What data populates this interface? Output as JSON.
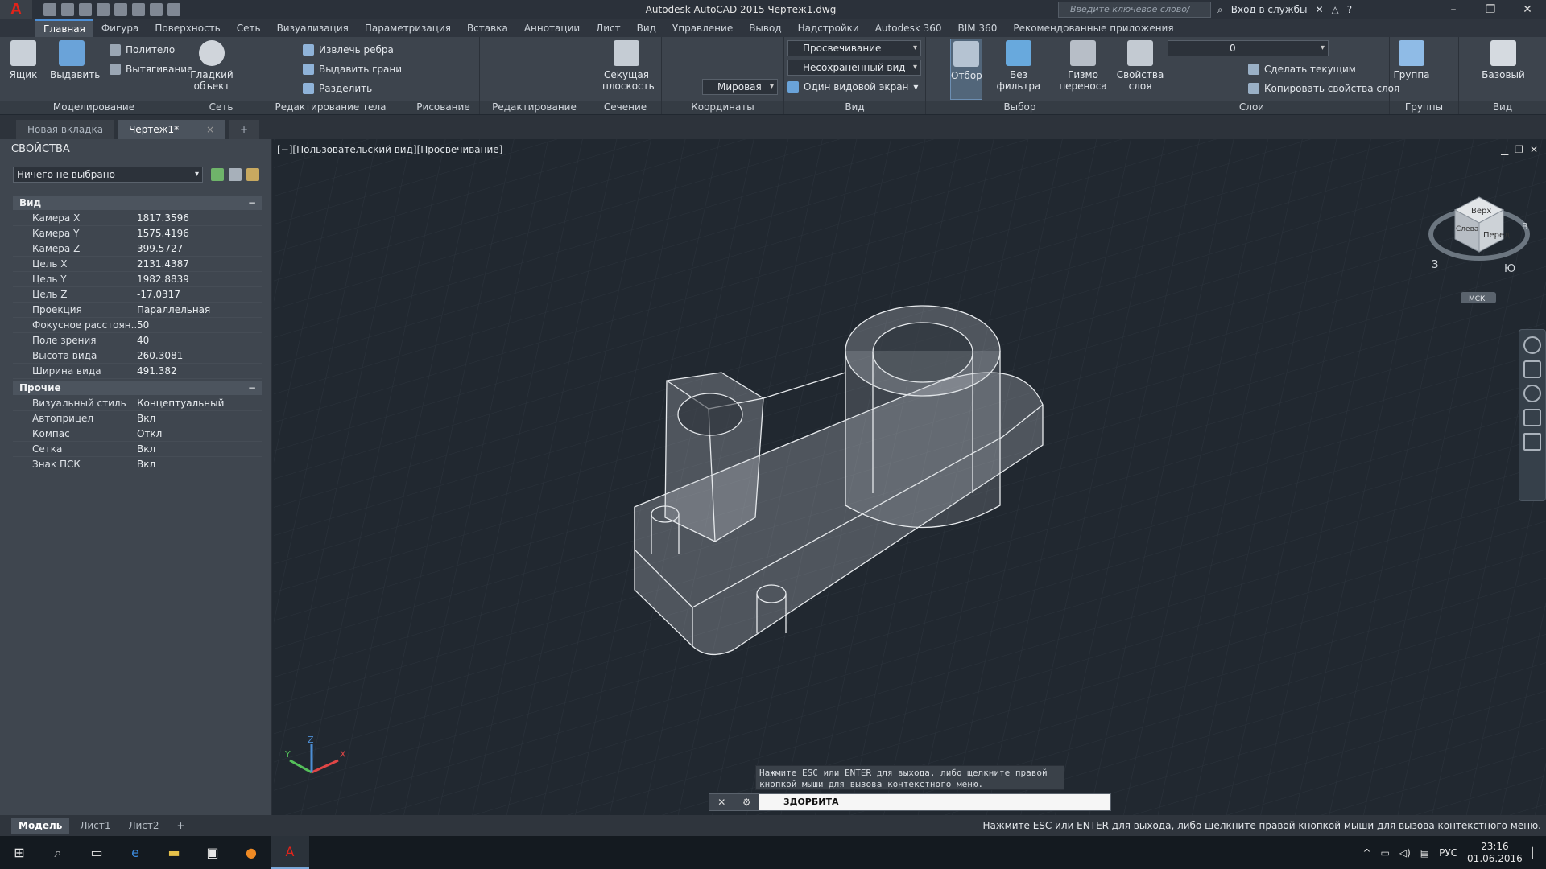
{
  "titlebar": {
    "title": "Autodesk AutoCAD 2015    Чертеж1.dwg",
    "search_placeholder": "Введите ключевое слово/фразу",
    "signin": "Вход в службы",
    "help": "?"
  },
  "ribbon_tabs": [
    "Главная",
    "Фигура",
    "Поверхность",
    "Сеть",
    "Визуализация",
    "Параметризация",
    "Вставка",
    "Аннотации",
    "Лист",
    "Вид",
    "Управление",
    "Вывод",
    "Надстройки",
    "Autodesk 360",
    "BIM 360",
    "Рекомендованные приложения"
  ],
  "ribbon": {
    "modeling": {
      "label": "Моделирование",
      "box": "Ящик",
      "extrude": "Выдавить",
      "polysolid": "Политело",
      "presspull": "Вытягивание"
    },
    "mesh": {
      "label": "Сеть",
      "smooth": "Гладкий объект"
    },
    "solid_edit": {
      "label": "Редактирование тела",
      "extract_edges": "Извлечь ребра",
      "extrude_faces": "Выдавить грани",
      "separate": "Разделить"
    },
    "draw": {
      "label": "Рисование"
    },
    "modify": {
      "label": "Редактирование"
    },
    "section": {
      "label": "Сечение",
      "plane": "Секущая плоскость"
    },
    "coords": {
      "label": "Координаты",
      "world": "Мировая"
    },
    "view": {
      "label": "Вид",
      "visual_style": "Просвечивание",
      "saved_view": "Несохраненный вид",
      "single_vp": "Один видовой экран"
    },
    "selection": {
      "label": "Выбор",
      "culling": "Отбор",
      "no_filter": "Без фильтра",
      "gizmo": "Гизмо переноса"
    },
    "layers": {
      "label": "Слои",
      "props": "Свойства слоя",
      "layer_name": "0",
      "make_current": "Сделать текущим",
      "match": "Копировать свойства слоя"
    },
    "groups": {
      "label": "Группы",
      "group": "Группа"
    },
    "view2": {
      "label": "Вид",
      "base": "Базовый"
    }
  },
  "doc_tabs": [
    "Новая вкладка",
    "Чертеж1*"
  ],
  "properties": {
    "title": "СВОЙСТВА",
    "selection": "Ничего не выбрано",
    "sections": [
      {
        "name": "Вид",
        "rows": [
          {
            "k": "Камера X",
            "v": "1817.3596"
          },
          {
            "k": "Камера Y",
            "v": "1575.4196"
          },
          {
            "k": "Камера Z",
            "v": "399.5727"
          },
          {
            "k": "Цель X",
            "v": "2131.4387"
          },
          {
            "k": "Цель Y",
            "v": "1982.8839"
          },
          {
            "k": "Цель Z",
            "v": "-17.0317"
          },
          {
            "k": "Проекция",
            "v": "Параллельная"
          },
          {
            "k": "Фокусное расстоян...",
            "v": "50"
          },
          {
            "k": "Поле зрения",
            "v": "40"
          },
          {
            "k": "Высота вида",
            "v": "260.3081"
          },
          {
            "k": "Ширина вида",
            "v": "491.382"
          }
        ]
      },
      {
        "name": "Прочие",
        "rows": [
          {
            "k": "Визуальный стиль",
            "v": "Концептуальный"
          },
          {
            "k": "Автоприцел",
            "v": "Вкл"
          },
          {
            "k": "Компас",
            "v": "Откл"
          },
          {
            "k": "Сетка",
            "v": "Вкл"
          },
          {
            "k": "Знак ПСК",
            "v": "Вкл"
          }
        ]
      }
    ]
  },
  "viewport": {
    "label": "[−][Пользовательский вид][Просвечивание]",
    "viewcube_top": "Верх",
    "viewcube_front": "Перед",
    "viewcube_left": "Слева",
    "compass_w": "З",
    "compass_s": "Ю",
    "compass_e": "В",
    "wcs": "МСК"
  },
  "command": {
    "hint": "Нажмите ESC или ENTER для выхода, либо щелкните правой кнопкой мыши для вызова контекстного меню.",
    "current": "3ДОРБИТА"
  },
  "layout_tabs": [
    "Модель",
    "Лист1",
    "Лист2",
    "+"
  ],
  "status_msg": "Нажмите ESC или ENTER для выхода, либо щелкните правой кнопкой мыши для вызова контекстного меню.",
  "tray": {
    "lang": "РУС",
    "time": "23:16",
    "date": "01.06.2016"
  },
  "colors": {
    "accent": "#4d8fd6",
    "brand": "#e2231a"
  }
}
